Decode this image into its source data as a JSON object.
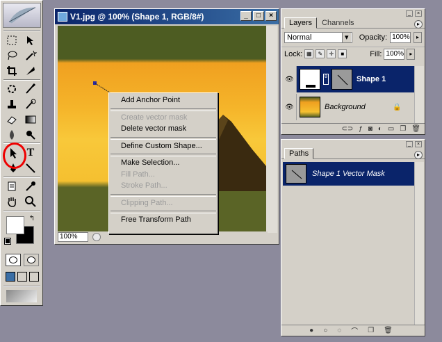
{
  "document": {
    "title": "V1.jpg @ 100% (Shape 1, RGB/8#)",
    "zoom": "100%",
    "window_buttons": {
      "minimize": "_",
      "maximize": "□",
      "close": "×"
    }
  },
  "context_menu": {
    "items": [
      {
        "label": "Add Anchor Point",
        "enabled": true
      },
      {
        "label": "Create vector mask",
        "enabled": false
      },
      {
        "label": "Delete vector mask",
        "enabled": true
      },
      {
        "label": "Define Custom Shape...",
        "enabled": true
      },
      {
        "label": "Make Selection...",
        "enabled": true
      },
      {
        "label": "Fill Path...",
        "enabled": false
      },
      {
        "label": "Stroke Path...",
        "enabled": false
      },
      {
        "label": "Clipping Path...",
        "enabled": false
      },
      {
        "label": "Free Transform Path",
        "enabled": true
      }
    ]
  },
  "layers_panel": {
    "tabs": [
      "Layers",
      "Channels"
    ],
    "active_tab": "Layers",
    "blend_mode": "Normal",
    "opacity_label": "Opacity:",
    "opacity_value": "100%",
    "lock_label": "Lock:",
    "fill_label": "Fill:",
    "fill_value": "100%",
    "layers": [
      {
        "name": "Shape 1",
        "selected": true,
        "visible": true
      },
      {
        "name": "Background",
        "selected": false,
        "visible": true,
        "locked": true
      }
    ]
  },
  "paths_panel": {
    "tabs": [
      "Paths"
    ],
    "active_tab": "Paths",
    "paths": [
      {
        "name": "Shape 1 Vector Mask",
        "selected": true
      }
    ]
  },
  "colors": {
    "selection": "#0a246a",
    "chrome": "#d4d0c8",
    "desktop": "#8c8a9c",
    "highlight_circle": "#ee0000"
  }
}
